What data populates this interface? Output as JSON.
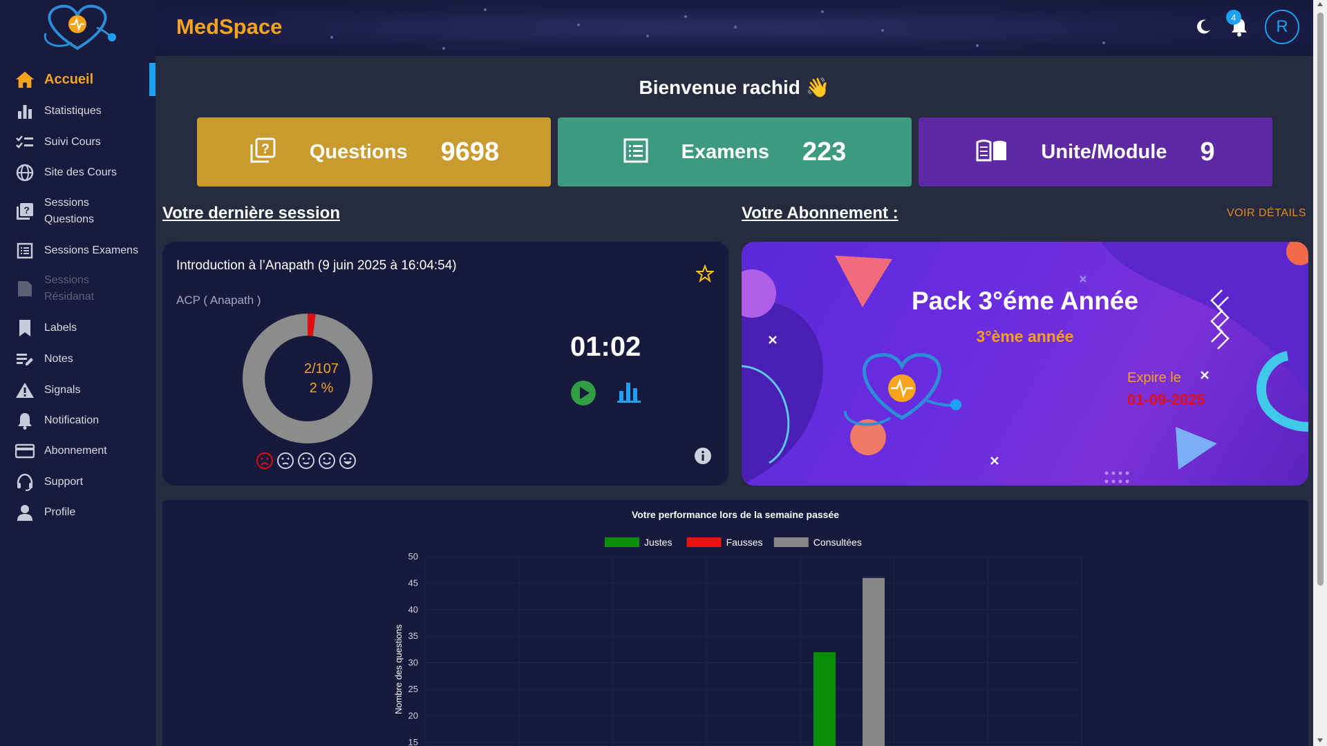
{
  "app": {
    "title": "MedSpace"
  },
  "topbar": {
    "notification_count": "4",
    "avatar_letter": "R"
  },
  "sidebar": {
    "items": [
      {
        "label": "Accueil",
        "icon": "home-icon"
      },
      {
        "label": "Statistiques",
        "icon": "bar-chart-icon"
      },
      {
        "label": "Suivi Cours",
        "icon": "checklist-icon"
      },
      {
        "label": "Site des Cours",
        "icon": "globe-icon"
      },
      {
        "label": "Sessions Questions",
        "icon": "question-book-icon"
      },
      {
        "label": "Sessions Examens",
        "icon": "list-icon"
      },
      {
        "label": "Sessions Résidanat",
        "icon": "document-icon"
      },
      {
        "label": "Labels",
        "icon": "bookmark-icon"
      },
      {
        "label": "Notes",
        "icon": "note-edit-icon"
      },
      {
        "label": "Signals",
        "icon": "warning-icon"
      },
      {
        "label": "Notification",
        "icon": "bell-icon"
      },
      {
        "label": "Abonnement",
        "icon": "credit-card-icon"
      },
      {
        "label": "Support",
        "icon": "headset-icon"
      },
      {
        "label": "Profile",
        "icon": "person-icon"
      }
    ]
  },
  "welcome": {
    "text": "Bienvenue rachid 👋"
  },
  "stats": [
    {
      "label": "Questions",
      "value": "9698",
      "color": "#c99a2e",
      "icon": "question-book-icon"
    },
    {
      "label": "Examens",
      "value": "223",
      "color": "#3e9a7e",
      "icon": "list-icon"
    },
    {
      "label": "Unite/Module",
      "value": "9",
      "color": "#5e2aa4",
      "icon": "open-book-icon"
    }
  ],
  "last_session": {
    "heading": "Votre dernière session",
    "title": "Introduction à l’Anapath (9 juin 2025 à 16:04:54)",
    "subtitle": "ACP ( Anapath )",
    "progress_text": "2/107",
    "progress_percent_text": "2 %",
    "progress_fraction": 0.0187,
    "timer": "01:02"
  },
  "subscription": {
    "heading": "Votre Abonnement :",
    "details_link": "VOIR DÉTAILS",
    "pack_title": "Pack 3°éme Année",
    "pack_subtitle": "3°ème année",
    "expire_label": "Expire le",
    "expire_date": "01-09-2025"
  },
  "chart_data": {
    "type": "bar",
    "title": "Votre performance lors de la semaine passée",
    "ylabel": "Nombre des questions",
    "xlabel": "",
    "y_ticks": [
      "50",
      "45",
      "40",
      "35",
      "30",
      "25",
      "20",
      "15"
    ],
    "ylim": [
      15,
      50
    ],
    "legend_position": "top",
    "series": [
      {
        "name": "Justes",
        "color": "#0b8f0b"
      },
      {
        "name": "Fausses",
        "color": "#ee1111"
      },
      {
        "name": "Consultées",
        "color": "#888888"
      }
    ],
    "visible_bars": [
      {
        "series": "Justes",
        "value": 32
      },
      {
        "series": "Consultées",
        "value": 46
      }
    ]
  }
}
